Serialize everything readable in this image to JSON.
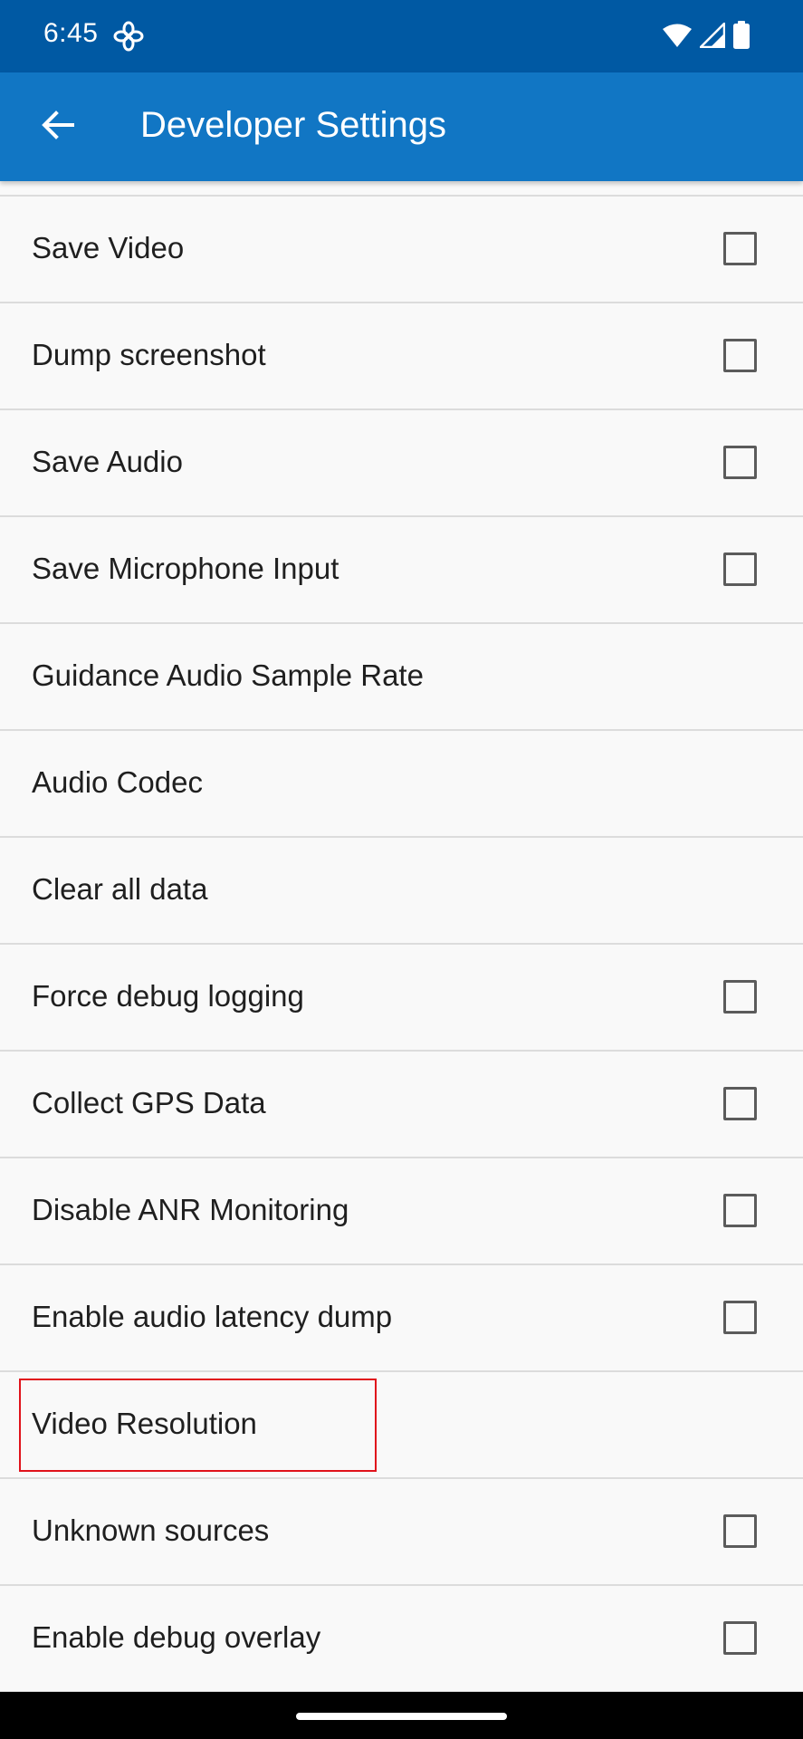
{
  "status_bar": {
    "time": "6:45",
    "icons": [
      "fan-icon",
      "wifi-icon",
      "signal-icon",
      "battery-icon"
    ]
  },
  "app_bar": {
    "back_icon": "arrow-back-icon",
    "title": "Developer Settings"
  },
  "settings": [
    {
      "label": "Save Video",
      "has_checkbox": true,
      "checked": false
    },
    {
      "label": "Dump screenshot",
      "has_checkbox": true,
      "checked": false
    },
    {
      "label": "Save Audio",
      "has_checkbox": true,
      "checked": false
    },
    {
      "label": "Save Microphone Input",
      "has_checkbox": true,
      "checked": false
    },
    {
      "label": "Guidance Audio Sample Rate",
      "has_checkbox": false
    },
    {
      "label": "Audio Codec",
      "has_checkbox": false
    },
    {
      "label": "Clear all data",
      "has_checkbox": false
    },
    {
      "label": "Force debug logging",
      "has_checkbox": true,
      "checked": false
    },
    {
      "label": "Collect GPS Data",
      "has_checkbox": true,
      "checked": false
    },
    {
      "label": "Disable ANR Monitoring",
      "has_checkbox": true,
      "checked": false
    },
    {
      "label": "Enable audio latency dump",
      "has_checkbox": true,
      "checked": false
    },
    {
      "label": "Video Resolution",
      "has_checkbox": false,
      "highlighted": true
    },
    {
      "label": "Unknown sources",
      "has_checkbox": true,
      "checked": false
    },
    {
      "label": "Enable debug overlay",
      "has_checkbox": true,
      "checked": false
    }
  ],
  "colors": {
    "status_bar": "#0059a3",
    "app_bar": "#1176c4",
    "background": "#f9f9f9",
    "divider": "#dcdcdc",
    "highlight": "#e0121b"
  }
}
